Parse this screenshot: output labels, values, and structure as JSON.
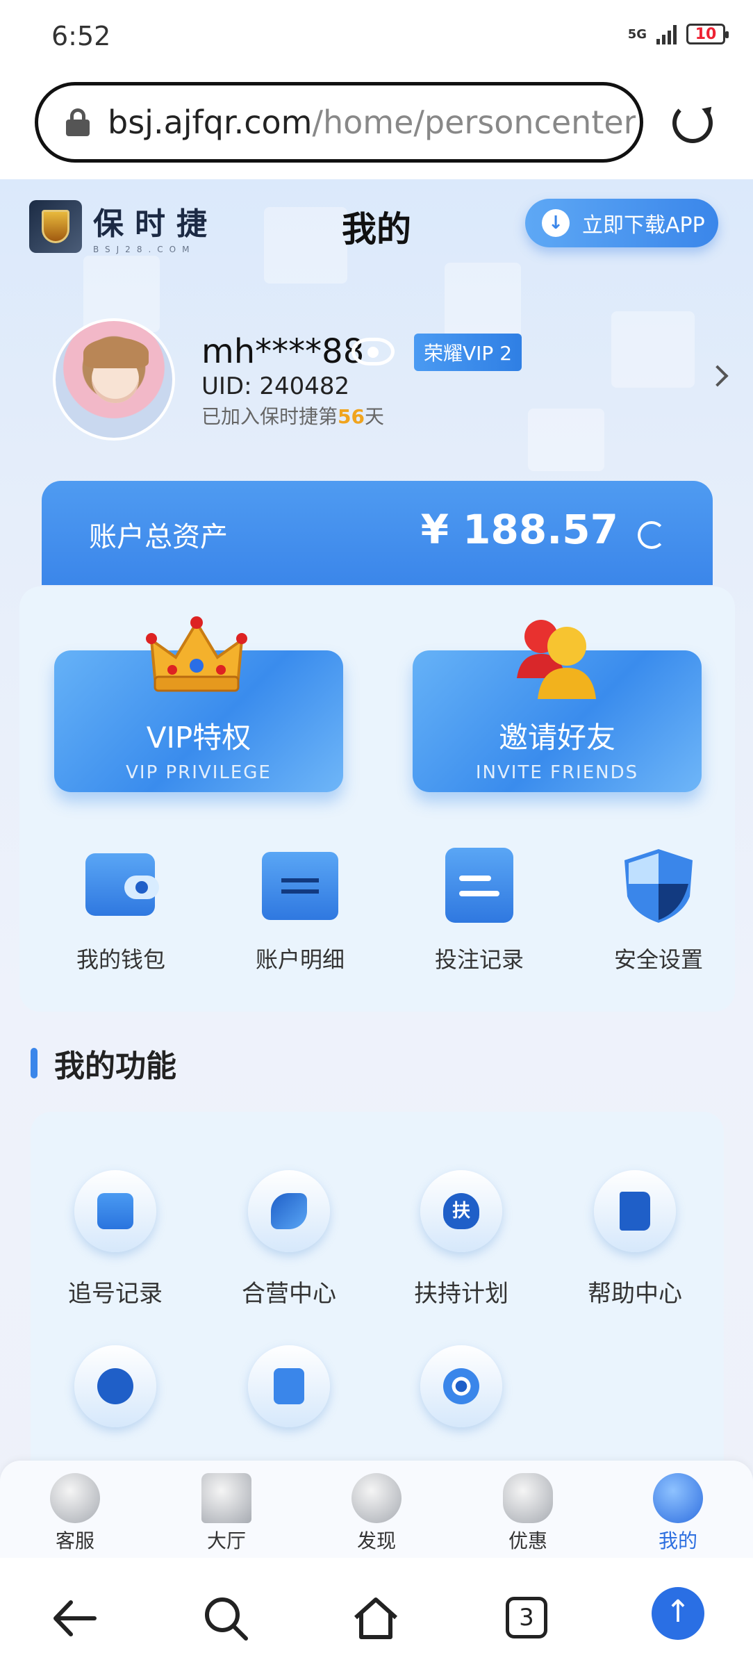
{
  "status_bar": {
    "time": "6:52",
    "battery": "10",
    "network": "5G"
  },
  "browser": {
    "url_host": "bsj.ajfqr.com",
    "url_path": "/home/personcenter?l"
  },
  "header": {
    "logo_cn": "保时捷",
    "logo_sub": "BSJ28.COM",
    "title": "我的",
    "download_label": "立即下载APP"
  },
  "profile": {
    "username": "mh****88",
    "vip": "荣耀VIP 2",
    "uid": "UID: 240482",
    "joined_prefix": "已加入保时捷第",
    "joined_days": "56",
    "joined_suffix": "天"
  },
  "assets": {
    "label": "账户总资产",
    "value": "¥ 188.57"
  },
  "promo": [
    {
      "title": "VIP特权",
      "subtitle": "VIP PRIVILEGE",
      "icon": "crown-icon"
    },
    {
      "title": "邀请好友",
      "subtitle": "INVITE FRIENDS",
      "icon": "friends-icon"
    }
  ],
  "quick": [
    {
      "label": "我的钱包",
      "icon": "wallet-icon"
    },
    {
      "label": "账户明细",
      "icon": "folder-transfer-icon"
    },
    {
      "label": "投注记录",
      "icon": "record-icon"
    },
    {
      "label": "安全设置",
      "icon": "shield-icon"
    }
  ],
  "section": {
    "title": "我的功能"
  },
  "functions": [
    {
      "label": "追号记录",
      "icon": "note-icon"
    },
    {
      "label": "合营中心",
      "icon": "handshake-icon"
    },
    {
      "label": "扶持计划",
      "icon": "support-icon",
      "badge": "扶"
    },
    {
      "label": "帮助中心",
      "icon": "book-icon"
    },
    {
      "label": "",
      "icon": "users-icon"
    },
    {
      "label": "",
      "icon": "tablet-icon"
    },
    {
      "label": "",
      "icon": "gear-icon"
    }
  ],
  "nav": [
    {
      "label": "客服",
      "icon": "headset-icon"
    },
    {
      "label": "大厅",
      "icon": "home-icon"
    },
    {
      "label": "发现",
      "icon": "discover-icon"
    },
    {
      "label": "优惠",
      "icon": "clover-icon"
    },
    {
      "label": "我的",
      "icon": "user-icon",
      "active": true
    }
  ],
  "system_nav": {
    "tab_count": "3"
  },
  "colors": {
    "accent": "#3a86ea",
    "highlight": "#f0a41e"
  }
}
